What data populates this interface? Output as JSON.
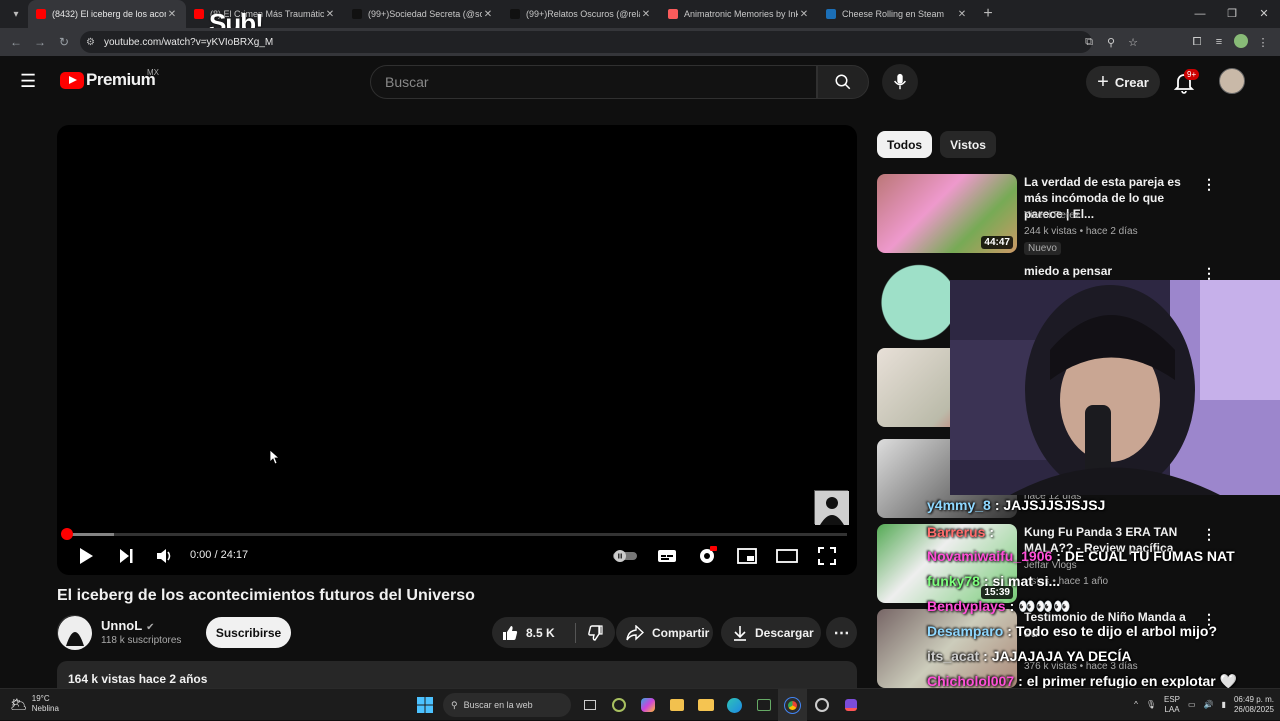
{
  "browser": {
    "tabs": [
      {
        "title": "(8432) El iceberg de los acontec",
        "favicon": "youtube",
        "active": true
      },
      {
        "title": "(8) El Crimen Más Traumátic",
        "favicon": "youtube",
        "active": false
      },
      {
        "title": "(99+)Sociedad Secreta (@socie",
        "favicon": "tiktok",
        "active": false
      },
      {
        "title": "(99+)Relatos Oscuros (@relato",
        "favicon": "tiktok",
        "active": false
      },
      {
        "title": "Animatronic Memories by Inks",
        "favicon": "itch",
        "active": false
      },
      {
        "title": "Cheese Rolling en Steam",
        "favicon": "steam",
        "active": false
      }
    ],
    "url": "youtube.com/watch?v=yKVIoBRXg_M",
    "overlay_text": "Sub!"
  },
  "masthead": {
    "logo_word": "Premium",
    "country_code": "MX",
    "search_placeholder": "Buscar",
    "create_label": "Crear",
    "notif_badge": "9+"
  },
  "player": {
    "time": "0:00 / 24:17",
    "progress": 0.0,
    "buffered": 0.06
  },
  "video": {
    "title": "El iceberg de los acontecimientos futuros del Universo",
    "channel": "UnnoL",
    "subscribers": "118 k suscriptores",
    "subscribe_label": "Suscribirse",
    "likes": "8.5 K",
    "share_label": "Compartir",
    "download_label": "Descargar",
    "views_date": "164 k vistas  hace 2 años"
  },
  "sidebar": {
    "chips": [
      "Todos",
      "Vistos"
    ],
    "recs": [
      {
        "title": "La verdad de esta pareja es más incómoda de lo que parece | El...",
        "channel": "Yiseni Perez",
        "meta": "244 k vistas • hace 2 días",
        "duration": "44:47",
        "badge": "Nuevo"
      },
      {
        "title": "miedo a pensar",
        "channel": "",
        "meta": "",
        "duration": "",
        "badge": ""
      },
      {
        "title": "",
        "channel": "",
        "meta": "",
        "duration": "",
        "badge": ""
      },
      {
        "title": "",
        "channel": "",
        "meta": "hace 12 días",
        "duration": "",
        "badge": ""
      },
      {
        "title": "Kung Fu Panda 3 ERA TAN MALA?? - Review pacífica",
        "channel": "Jeffar Vlogs",
        "meta": "vistas • hace 1 año",
        "duration": "15:39",
        "badge": ""
      },
      {
        "title": "Testimonio de Niño Manda a su",
        "channel": "",
        "meta": "376 k vistas • hace 3 días",
        "duration": "",
        "badge": ""
      }
    ]
  },
  "chat": [
    {
      "user": "y4mmy_8",
      "msg": ": JAJSJJSJSJSJ",
      "color": "#8fd8ff"
    },
    {
      "user": "Barrerus",
      "msg": ":",
      "color": "#ff6b6b"
    },
    {
      "user": "Novamiwaifu_1906",
      "msg": ": DE CUAL TU FUMAS NAT",
      "color": "#ff4fd8"
    },
    {
      "user": "funky78",
      "msg": ": si mat si...",
      "color": "#7dff7d"
    },
    {
      "user": "Bendyplays",
      "msg": ": 👀👀👀",
      "color": "#ff4fd8"
    },
    {
      "user": "Desamparo",
      "msg": ": Todo eso te dijo el arbol mijo?",
      "color": "#8fd8ff"
    },
    {
      "user": "its_acat",
      "msg": ": JAJAJAJA YA DECÍA",
      "color": "#d0d0d0"
    },
    {
      "user": "Chicholol007",
      "msg": ": el primer refugio en explotar 🤍",
      "color": "#ff4fd8"
    }
  ],
  "taskbar": {
    "temp": "19°C",
    "weather": "Neblina",
    "search_label": "Buscar en la web",
    "lang": "ESP",
    "lang2": "LAA",
    "time": "06:49 p. m.",
    "date": "26/08/2025"
  }
}
